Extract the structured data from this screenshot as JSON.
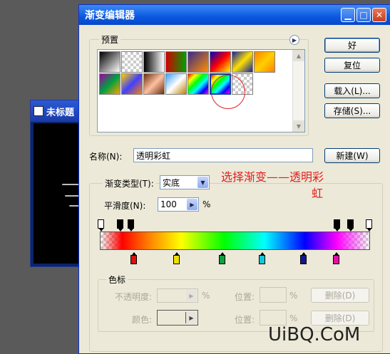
{
  "bg_window": {
    "title": "未标题"
  },
  "dialog": {
    "title": "渐变编辑器",
    "presets_label": "预置",
    "buttons": {
      "ok": "好",
      "reset": "复位",
      "load": "载入(L)...",
      "save": "存储(S)...",
      "new": "新建(W)"
    },
    "name_label": "名称(N):",
    "name_value": "透明彩虹",
    "gradient_type_label": "渐变类型(T):",
    "gradient_type_value": "实底",
    "smoothness_label": "平滑度(N):",
    "smoothness_value": "100",
    "smoothness_unit": "%",
    "stops_group_label": "色标",
    "opacity_label": "不透明度:",
    "opacity_unit": "%",
    "position_label": "位置:",
    "position_unit": "%",
    "delete_label": "删除(D)",
    "color_label": "颜色:"
  },
  "annotation": {
    "line1": "选择渐变——透明彩",
    "line2": "虹"
  },
  "watermark": "UiBQ.CoM"
}
